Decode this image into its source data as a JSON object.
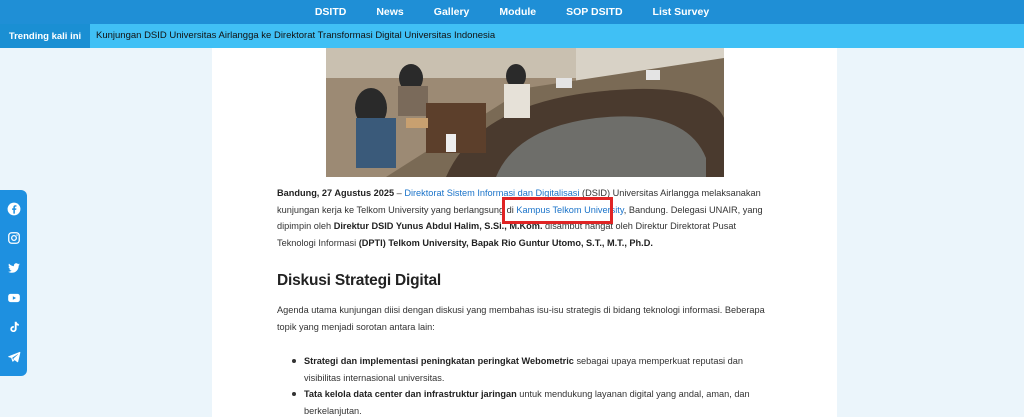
{
  "nav": {
    "items": [
      "DSITD",
      "News",
      "Gallery",
      "Module",
      "SOP DSITD",
      "List Survey"
    ]
  },
  "trending": {
    "label": "Trending kali ini",
    "headline": "Kunjungan DSID Universitas Airlangga ke Direktorat Transformasi Digital Universitas Indonesia"
  },
  "article": {
    "p1": {
      "date": "Bandung, 27 Agustus 2025",
      "dash": " – ",
      "link1": "Direktorat Sistem Informasi dan Digitalisasi",
      "t1": " (DSID) Universitas Airlangga melaksanakan kunjungan kerja ke Telkom University yang berlangsung di ",
      "link2": "Kampus Telkom University",
      "t2": ", Bandung. Delegasi UNAIR, yang dipimpin oleh ",
      "bold1": "Direktur DSID Yunus Abdul Halim, S.Si., M.Kom.",
      "t3": " disambut hangat oleh Direktur Direktorat Pusat Teknologi Informasi ",
      "bold2": "(DPTI) Telkom University, Bapak Rio Guntur Utomo, S.T., M.T., Ph.D."
    },
    "section_title": "Diskusi Strategi Digital",
    "p2": "Agenda utama kunjungan diisi dengan diskusi yang membahas isu-isu strategis di bidang teknologi informasi. Beberapa topik yang menjadi sorotan antara lain:",
    "bullets": [
      {
        "bold": "Strategi dan implementasi peningkatan peringkat Webometric",
        "text": " sebagai upaya memperkuat reputasi dan visibilitas internasional universitas."
      },
      {
        "bold": "Tata kelola data center dan infrastruktur jaringan",
        "text": " untuk mendukung layanan digital yang andal, aman, dan berkelanjutan."
      }
    ]
  },
  "social": {
    "icons": [
      "facebook-icon",
      "instagram-icon",
      "twitter-icon",
      "youtube-icon",
      "tiktok-icon",
      "telegram-icon"
    ],
    "color": "#1e90e0"
  },
  "colors": {
    "nav_bg": "#1f8fd6",
    "trending_bg": "#40c0f5",
    "link": "#1a73c9",
    "highlight_box": "#e02424"
  }
}
